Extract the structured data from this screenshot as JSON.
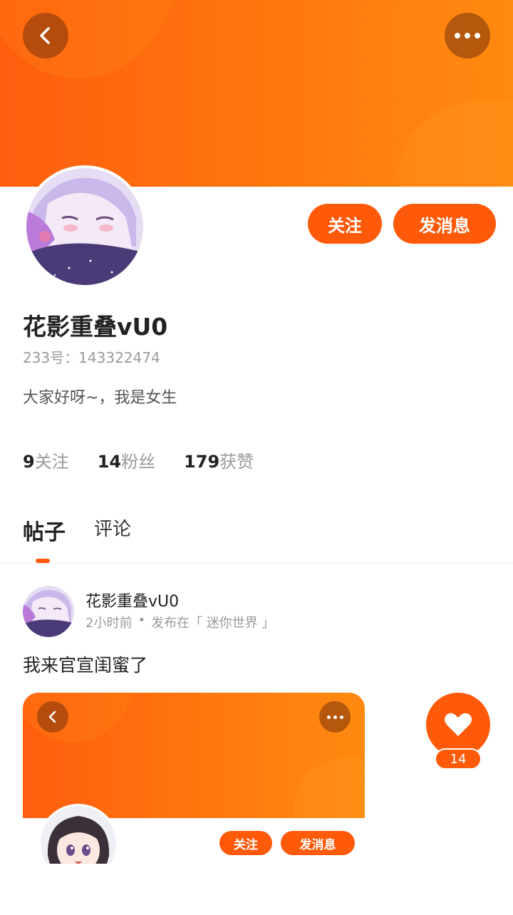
{
  "header": {
    "back_icon": "chevron-left-icon",
    "more_icon": "more-dots-icon"
  },
  "profile": {
    "username": "花影重叠vU0",
    "uid": "233号：143322474",
    "bio": "大家好呀~，我是女生",
    "follow_label": "关注",
    "message_label": "发消息"
  },
  "stats": [
    {
      "value": "9",
      "label": "关注"
    },
    {
      "value": "14",
      "label": "粉丝"
    },
    {
      "value": "179",
      "label": "获赞"
    }
  ],
  "tabs": [
    {
      "label": "帖子",
      "active": true
    },
    {
      "label": "评论",
      "active": false
    }
  ],
  "post": {
    "author": "花影重叠vU0",
    "time": "2小时前",
    "separator": "•",
    "published_in": "发布在「 迷你世界 」",
    "text": "我来官宣闺蜜了",
    "image": {
      "follow_label": "关注",
      "message_label": "发消息"
    },
    "like_count": "14"
  },
  "colors": {
    "accent": "#ff5a0a",
    "banner_start": "#ff5e0e",
    "banner_end": "#ff8a10"
  }
}
